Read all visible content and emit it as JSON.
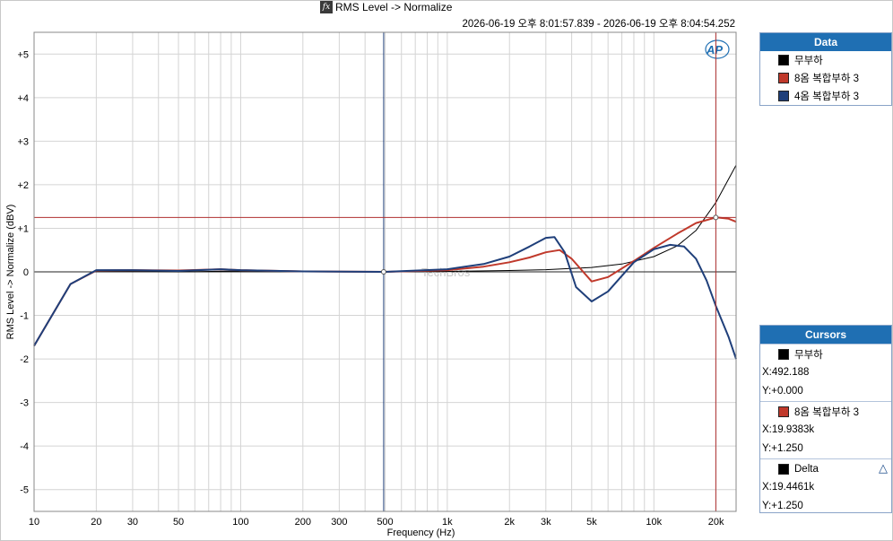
{
  "header": {
    "fx_symbol": "fx",
    "title": "RMS Level -> Normalize",
    "time_range": "2026-06-19 오후 8:01:57.839 - 2026-06-19 오후 8:04:54.252"
  },
  "watermark": {
    "logo": "AP",
    "brand": "TechBros"
  },
  "legend": {
    "title": "Data",
    "items": [
      {
        "label": "무부하",
        "color": "#000000"
      },
      {
        "label": "8옴 복합부하 3",
        "color": "#c0392b"
      },
      {
        "label": "4옴 복합부하 3",
        "color": "#1f3f7a"
      }
    ]
  },
  "cursors": {
    "title": "Cursors",
    "blocks": [
      {
        "name": "무부하",
        "color": "#000000",
        "x": "X:492.188",
        "y": "Y:+0.000"
      },
      {
        "name": "8옴 복합부하 3",
        "color": "#c0392b",
        "x": "X:19.9383k",
        "y": "Y:+1.250"
      },
      {
        "name": "Delta",
        "color": "#000000",
        "x": "X:19.4461k",
        "y": "Y:+1.250",
        "icon": "delta-icon"
      }
    ]
  },
  "colors": {
    "grid": "#d4d4d4",
    "cursor_blue": "#1f3f7a",
    "cursor_red": "#b03030",
    "header_bg": "#1f6fb3"
  },
  "chart_data": {
    "type": "line",
    "title": "RMS Level -> Normalize",
    "xlabel": "Frequency (Hz)",
    "ylabel": "RMS Level -> Normalize (dBV)",
    "x_scale": "log",
    "xlim": [
      10,
      25000
    ],
    "ylim": [
      -5.5,
      5.5
    ],
    "grid": true,
    "legend_position": "right",
    "x_ticks": [
      10,
      20,
      30,
      50,
      100,
      200,
      300,
      500,
      1000,
      2000,
      3000,
      5000,
      10000,
      20000
    ],
    "x_tick_labels": [
      "10",
      "20",
      "30",
      "50",
      "100",
      "200",
      "300",
      "500",
      "1k",
      "2k",
      "3k",
      "5k",
      "10k",
      "20k"
    ],
    "y_ticks": [
      5,
      4,
      3,
      2,
      1,
      0,
      -1,
      -2,
      -3,
      -4,
      -5
    ],
    "y_tick_labels": [
      "+5",
      "+4",
      "+3",
      "+2",
      "+1",
      "0",
      "-1",
      "-2",
      "-3",
      "-4",
      "-5"
    ],
    "series": [
      {
        "name": "무부하",
        "color": "#000000",
        "x": [
          10,
          15,
          20,
          30,
          50,
          100,
          200,
          500,
          1000,
          2000,
          3000,
          5000,
          7000,
          10000,
          13000,
          16000,
          20000,
          25000
        ],
        "y": [
          -1.7,
          -0.28,
          0.02,
          0.02,
          0.0,
          0.02,
          0.01,
          0.0,
          0.01,
          0.03,
          0.05,
          0.1,
          0.18,
          0.35,
          0.6,
          0.95,
          1.6,
          2.45
        ]
      },
      {
        "name": "8옴 복합부하 3",
        "color": "#c0392b",
        "x": [
          10,
          15,
          20,
          30,
          50,
          80,
          100,
          200,
          500,
          1000,
          1500,
          2000,
          2500,
          3000,
          3500,
          4000,
          5000,
          6000,
          8000,
          10000,
          13000,
          16000,
          20000,
          23000,
          25000
        ],
        "y": [
          -1.7,
          -0.28,
          0.03,
          0.04,
          0.03,
          0.06,
          0.04,
          0.01,
          0.0,
          0.04,
          0.12,
          0.22,
          0.33,
          0.45,
          0.5,
          0.3,
          -0.22,
          -0.12,
          0.25,
          0.55,
          0.88,
          1.12,
          1.25,
          1.22,
          1.15
        ]
      },
      {
        "name": "4옴 복합부하 3",
        "color": "#1f3f7a",
        "x": [
          10,
          15,
          20,
          30,
          50,
          80,
          100,
          200,
          500,
          1000,
          1500,
          2000,
          2500,
          3000,
          3300,
          3700,
          4200,
          5000,
          6000,
          8000,
          10000,
          12000,
          14000,
          16000,
          18000,
          20000,
          23000,
          25000
        ],
        "y": [
          -1.7,
          -0.28,
          0.04,
          0.04,
          0.02,
          0.06,
          0.04,
          0.01,
          0.0,
          0.06,
          0.18,
          0.35,
          0.58,
          0.78,
          0.8,
          0.45,
          -0.35,
          -0.68,
          -0.45,
          0.22,
          0.52,
          0.62,
          0.58,
          0.3,
          -0.2,
          -0.8,
          -1.5,
          -2.0
        ]
      }
    ],
    "cursor_lines": [
      {
        "axis": "x",
        "value": 492.188,
        "color": "#1f3f7a"
      },
      {
        "axis": "x",
        "value": 19938.3,
        "color": "#b03030"
      },
      {
        "axis": "y",
        "value": 1.25,
        "color": "#b03030"
      }
    ],
    "cursor_markers": [
      {
        "x": 492.188,
        "y": 0.0
      },
      {
        "x": 19938.3,
        "y": 1.25
      }
    ]
  }
}
